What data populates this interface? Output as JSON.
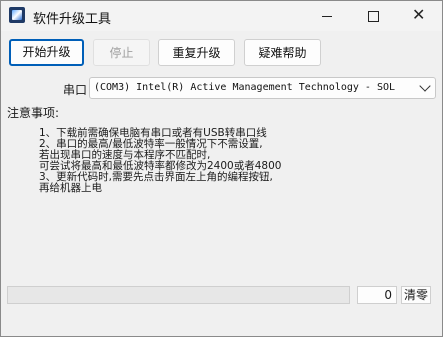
{
  "window": {
    "title": "软件升级工具",
    "icon": "app-icon",
    "controls": {
      "minimize": "minimize-icon",
      "maximize": "maximize-icon",
      "close": "close-icon"
    }
  },
  "toolbar": {
    "start_label": "开始升级",
    "stop_label": "停止",
    "reupgrade_label": "重复升级",
    "help_label": "疑难帮助"
  },
  "port": {
    "label": "串口",
    "selected": "(COM3) Intel(R) Active Management Technology - SOL"
  },
  "notes": {
    "title": "注意事项:",
    "lines": [
      "1、下载前需确保电脑有串口或者有USB转串口线",
      "2、串口的最高/最低波特率一般情况下不需设置,",
      "   若出现串口的速度与本程序不匹配时,",
      "   可尝试将最高和最低波特率都修改为2400或者4800",
      "3、更新代码时,需要先点击界面左上角的编程按钮,",
      "   再给机器上电"
    ]
  },
  "status": {
    "count": "0",
    "clear_label": "清零"
  }
}
